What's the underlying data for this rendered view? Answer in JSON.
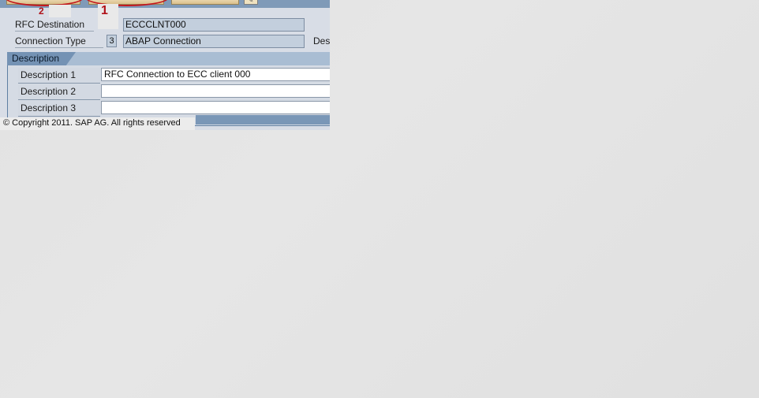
{
  "form": {
    "rfc_destination": {
      "label": "RFC Destination",
      "value": "ECCCLNT000"
    },
    "connection_type": {
      "label": "Connection Type",
      "code": "3",
      "value": "ABAP Connection"
    },
    "cut_off_label": "Des"
  },
  "description_group": {
    "title": "Description",
    "fields": [
      {
        "label": "Description 1",
        "value": "RFC Connection to ECC client 000"
      },
      {
        "label": "Description 2",
        "value": ""
      },
      {
        "label": "Description 3",
        "value": ""
      }
    ]
  },
  "annotations": {
    "marker_1": "1",
    "marker_2": "2",
    "color": "#c4161c"
  },
  "footer": {
    "copyright": "© Copyright 2011. SAP AG. All rights reserved"
  },
  "colors": {
    "toolbar": "#7f9ab8",
    "group_header": "#7492b4",
    "input_readonly": "#c3cfdd",
    "input_editable": "#ffffff"
  }
}
